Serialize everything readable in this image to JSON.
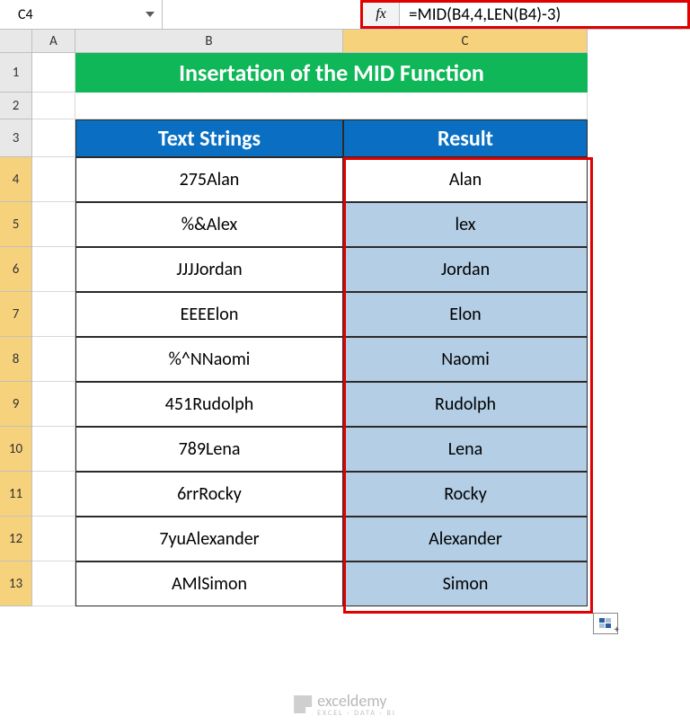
{
  "namebox": "C4",
  "fx_label": "fx",
  "formula": "=MID(B4,4,LEN(B4)-3)",
  "columns": {
    "A": "A",
    "B": "B",
    "C": "C"
  },
  "rows": [
    "1",
    "2",
    "3",
    "4",
    "5",
    "6",
    "7",
    "8",
    "9",
    "10",
    "11",
    "12",
    "13"
  ],
  "title": "Insertation of the MID Function",
  "headers": {
    "text_strings": "Text Strings",
    "result": "Result"
  },
  "data": [
    {
      "text": "275Alan",
      "result": "Alan"
    },
    {
      "text": "%&Alex",
      "result": "lex"
    },
    {
      "text": "JJJJordan",
      "result": "Jordan"
    },
    {
      "text": "EEEElon",
      "result": "Elon"
    },
    {
      "text": "%^NNaomi",
      "result": "Naomi"
    },
    {
      "text": "451Rudolph",
      "result": "Rudolph"
    },
    {
      "text": "789Lena",
      "result": "Lena"
    },
    {
      "text": "6rrRocky",
      "result": "Rocky"
    },
    {
      "text": "7yuAlexander",
      "result": "Alexander"
    },
    {
      "text": "AMlSimon",
      "result": "Simon"
    }
  ],
  "branding": {
    "name": "exceldemy",
    "tagline": "EXCEL · DATA · BI"
  },
  "chart_data": {
    "type": "table",
    "title": "Insertation of the MID Function",
    "columns": [
      "Text Strings",
      "Result"
    ],
    "rows": [
      [
        "275Alan",
        "Alan"
      ],
      [
        "%&Alex",
        "lex"
      ],
      [
        "JJJJordan",
        "Jordan"
      ],
      [
        "EEEElon",
        "Elon"
      ],
      [
        "%^NNaomi",
        "Naomi"
      ],
      [
        "451Rudolph",
        "Rudolph"
      ],
      [
        "789Lena",
        "Lena"
      ],
      [
        "6rrRocky",
        "Rocky"
      ],
      [
        "7yuAlexander",
        "Alexander"
      ],
      [
        "AMlSimon",
        "Simon"
      ]
    ]
  }
}
